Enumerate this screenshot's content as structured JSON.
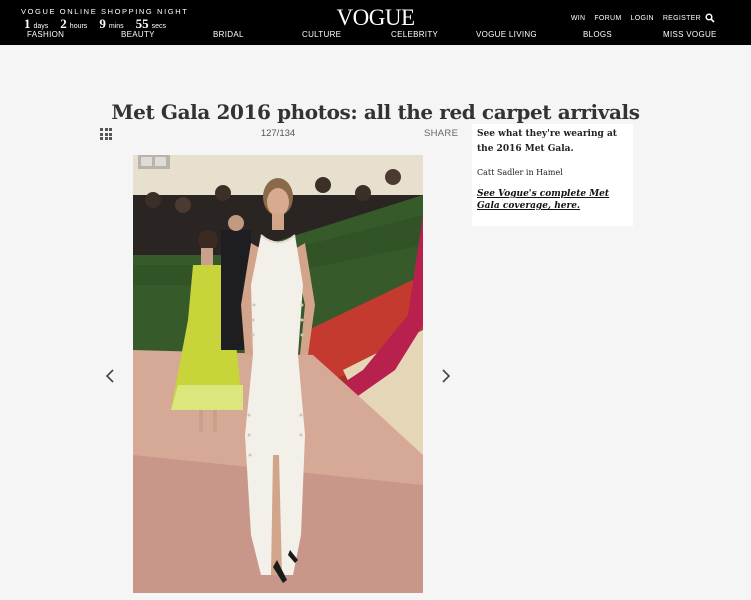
{
  "header": {
    "promo_title": "VOGUE ONLINE SHOPPING NIGHT",
    "countdown": [
      {
        "num": "1",
        "label": "days"
      },
      {
        "num": "2",
        "label": "hours"
      },
      {
        "num": "9",
        "label": "mins"
      },
      {
        "num": "55",
        "label": "secs"
      }
    ],
    "logo": "VOGUE",
    "util_links": [
      "WIN",
      "FORUM",
      "LOGIN",
      "REGISTER"
    ],
    "search_icon": "search-icon",
    "nav": [
      "FASHION",
      "BEAUTY",
      "BRIDAL",
      "CULTURE",
      "CELEBRITY",
      "VOGUE LIVING",
      "BLOGS",
      "MISS VOGUE"
    ]
  },
  "gallery": {
    "title": "Met Gala 2016 photos: all the red carpet arrivals",
    "counter": "127/134",
    "share_label": "SHARE",
    "grid_icon": "grid-icon",
    "prev_icon": "chevron-left-icon",
    "next_icon": "chevron-right-icon"
  },
  "sidebar": {
    "heading": "See what they're wearing at the 2016 Met Gala.",
    "caption": "Catt Sadler in Hamel",
    "link": "See Vogue's complete Met Gala coverage, here."
  },
  "colors": {
    "topbar": "#000000",
    "page_bg": "#f5f5f5",
    "title": "#333333"
  }
}
